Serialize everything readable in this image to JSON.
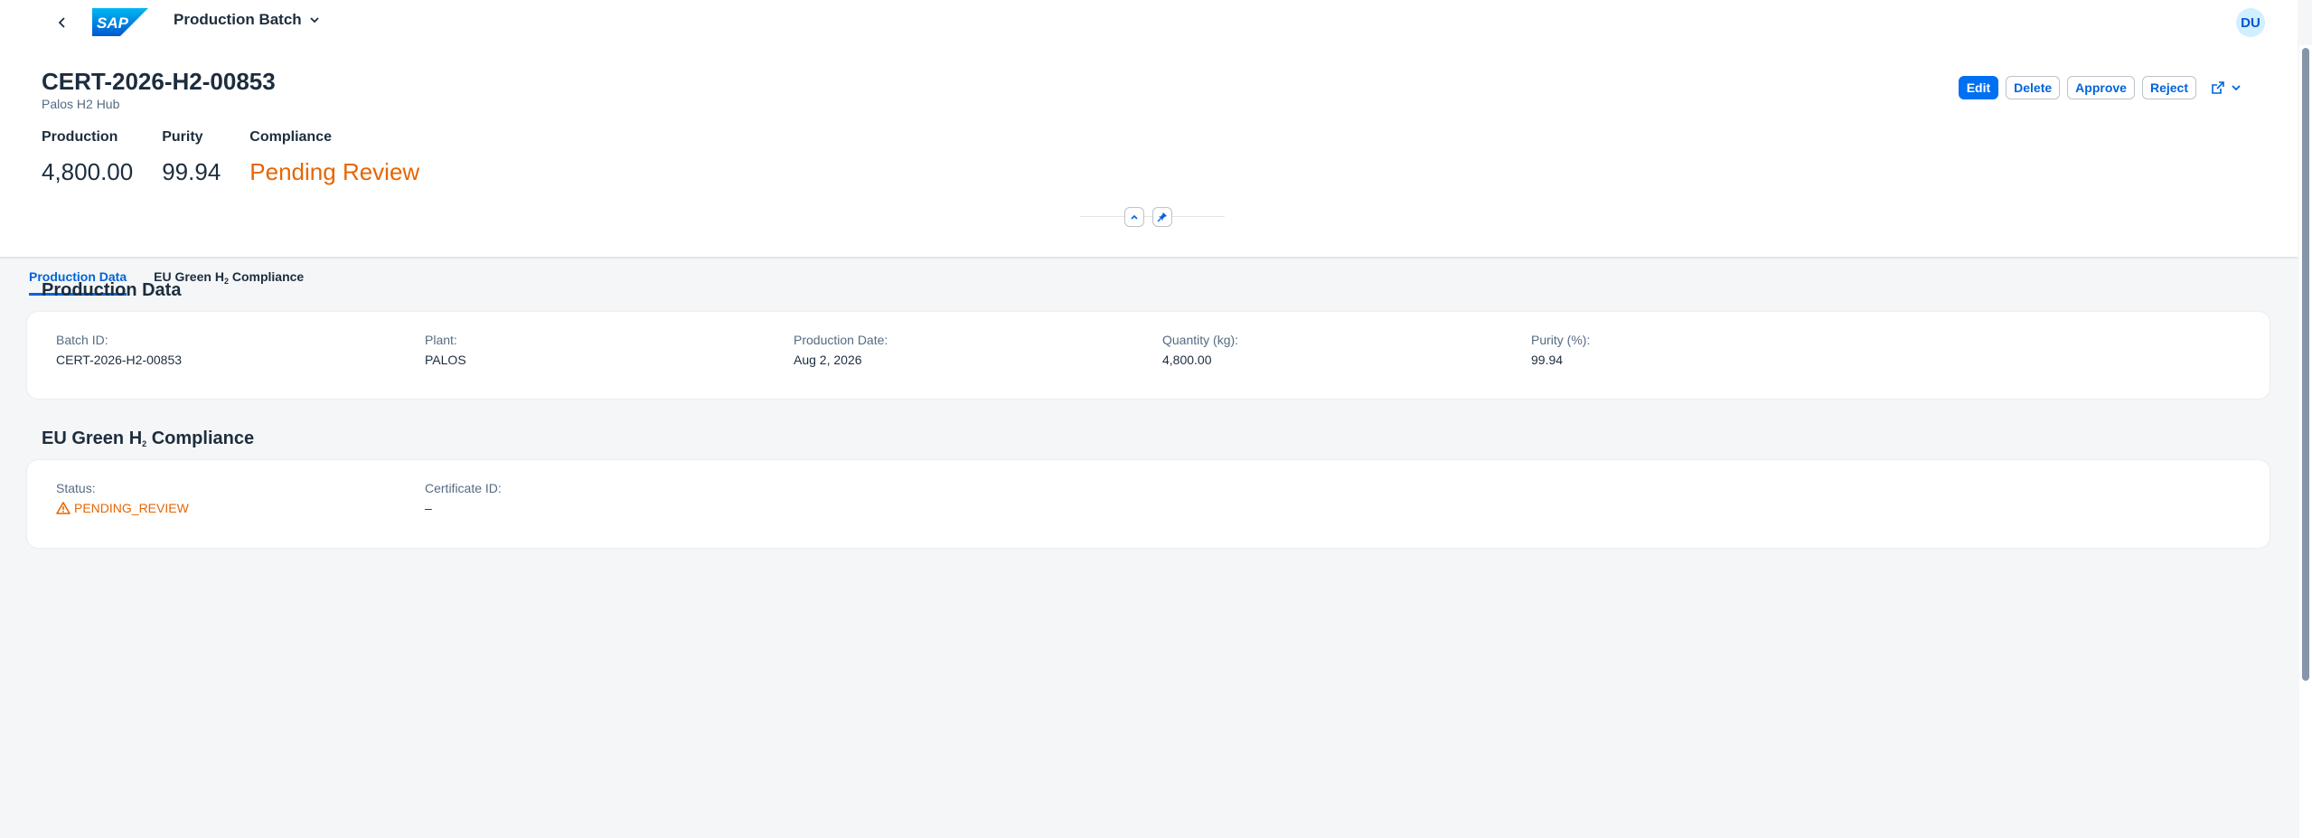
{
  "shell": {
    "logo_text": "SAP",
    "app_title": "Production Batch",
    "avatar_initials": "DU"
  },
  "header": {
    "title": "CERT-2026-H2-00853",
    "subtitle": "Palos H2 Hub",
    "actions": {
      "edit": "Edit",
      "delete": "Delete",
      "approve": "Approve",
      "reject": "Reject"
    },
    "kpis": [
      {
        "label": "Production",
        "value": "4,800.00"
      },
      {
        "label": "Purity",
        "value": "99.94"
      },
      {
        "label": "Compliance",
        "value": "Pending Review"
      }
    ]
  },
  "tabs": {
    "production": "Production Data",
    "compliance_pre": "EU Green H",
    "compliance_sub": "2",
    "compliance_post": " Compliance"
  },
  "sections": {
    "production": {
      "title": "Production Data",
      "fields": [
        {
          "label": "Batch ID:",
          "value": "CERT-2026-H2-00853"
        },
        {
          "label": "Plant:",
          "value": "PALOS"
        },
        {
          "label": "Production Date:",
          "value": "Aug 2, 2026"
        },
        {
          "label": "Quantity (kg):",
          "value": "4,800.00"
        },
        {
          "label": "Purity (%):",
          "value": "99.94"
        }
      ]
    },
    "compliance": {
      "title_pre": "EU Green H",
      "title_sub": "2",
      "title_post": " Compliance",
      "fields": [
        {
          "label": "Status:",
          "value": "PENDING_REVIEW"
        },
        {
          "label": "Certificate ID:",
          "value": "–"
        }
      ]
    }
  },
  "colors": {
    "brand": "#0070f2",
    "link": "#0064d9",
    "warning": "#e76500"
  },
  "icons": {
    "back": "chevron-left-icon",
    "menu": "chevron-down-icon",
    "share": "share-icon",
    "collapse": "chevron-up-icon",
    "pin": "pin-icon",
    "warning": "warning-icon"
  }
}
